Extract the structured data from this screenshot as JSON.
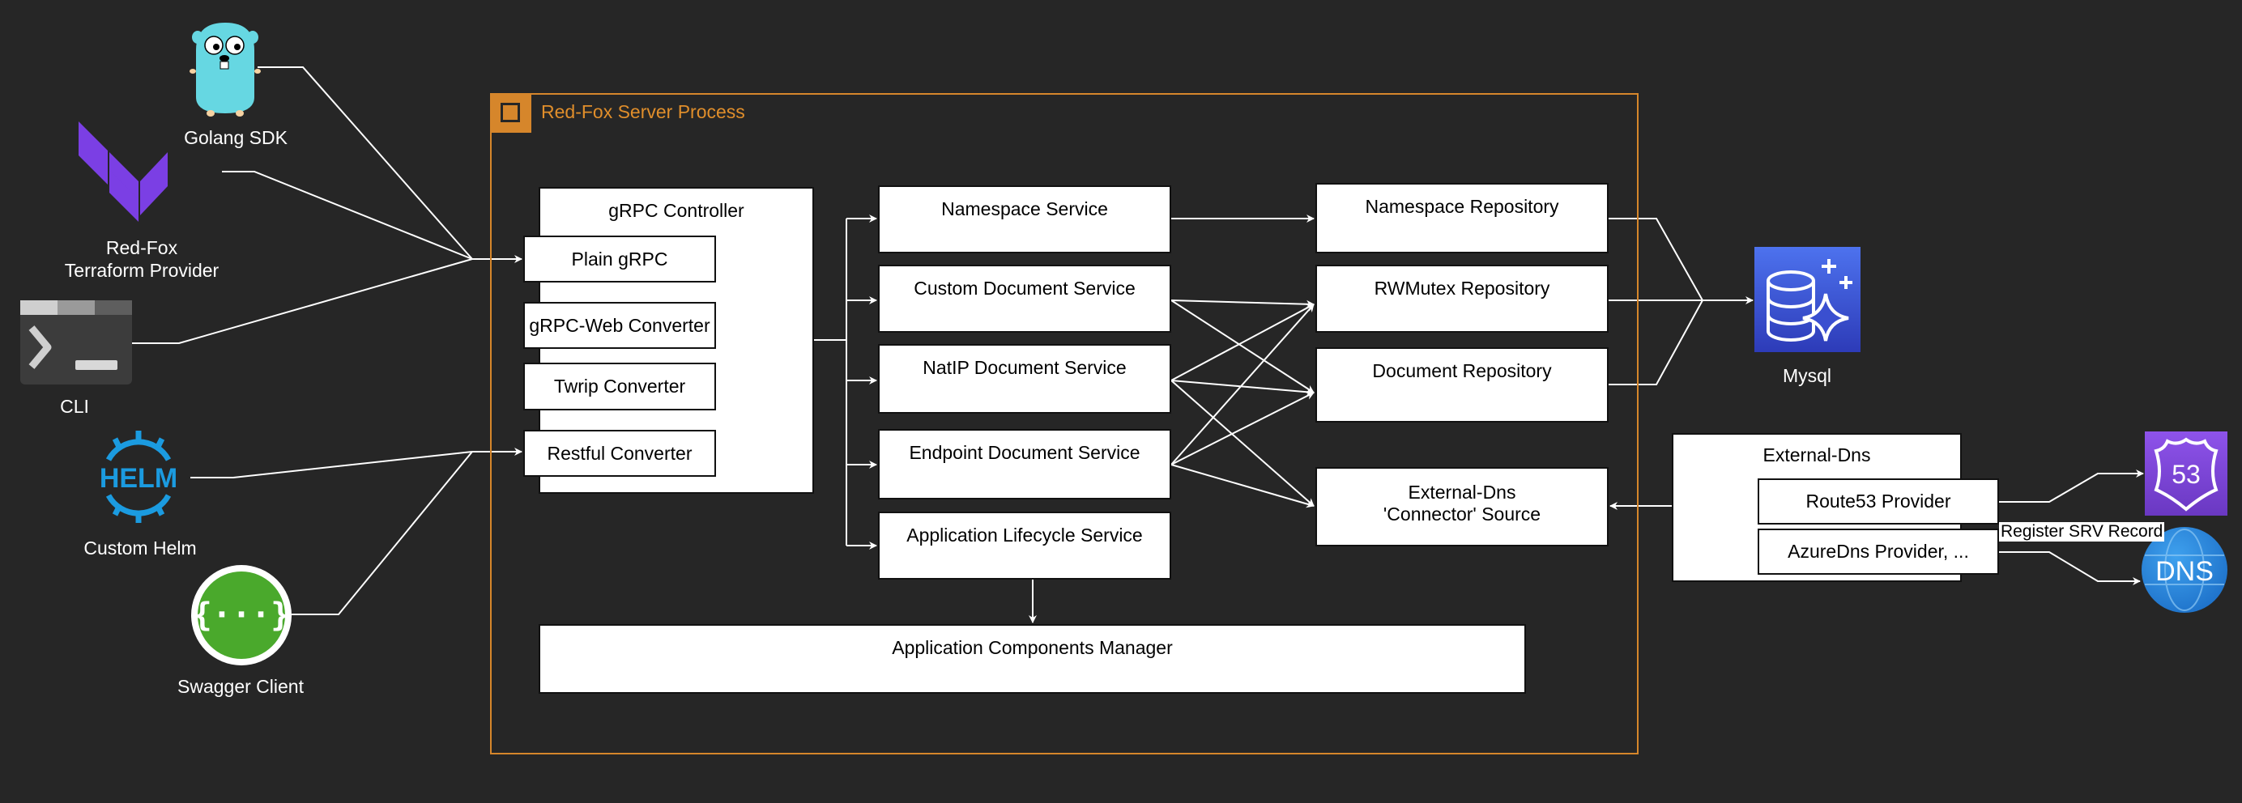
{
  "clients": {
    "golang_sdk": "Golang SDK",
    "terraform_line1": "Red-Fox",
    "terraform_line2": "Terraform Provider",
    "cli": "CLI",
    "custom_helm": "Custom Helm",
    "helm_logo_text": "HELM",
    "swagger_client": "Swagger Client"
  },
  "server": {
    "title": "Red-Fox Server Process",
    "grpc_controller": {
      "title": "gRPC Controller",
      "converters": [
        "Plain gRPC",
        "gRPC-Web Converter",
        "Twrip Converter",
        "Restful Converter"
      ]
    },
    "services": [
      "Namespace Service",
      "Custom Document Service",
      "NatIP Document Service",
      "Endpoint Document Service",
      "Application Lifecycle Service"
    ],
    "repositories": [
      "Namespace Repository",
      "RWMutex Repository",
      "Document Repository"
    ],
    "connector_line1": "External-Dns",
    "connector_line2": "'Connector' Source",
    "components_manager": "Application Components Manager"
  },
  "mysql": {
    "label": "Mysql"
  },
  "external_dns": {
    "title": "External-Dns",
    "providers": [
      "Route53 Provider",
      "AzureDns Provider, ..."
    ],
    "edge_label": "Register SRV Record",
    "route53_icon_text": "53",
    "dns_icon_text": "DNS"
  },
  "colors": {
    "background": "#262626",
    "server_border": "#d6862b",
    "terraform": "#7b3fe4",
    "gopher": "#66d7e2",
    "mysql": "#3b52d8",
    "route53": "#7a46d6",
    "dns": "#1f7fd6",
    "helm": "#1b9be0",
    "swagger": "#4aa92c"
  }
}
